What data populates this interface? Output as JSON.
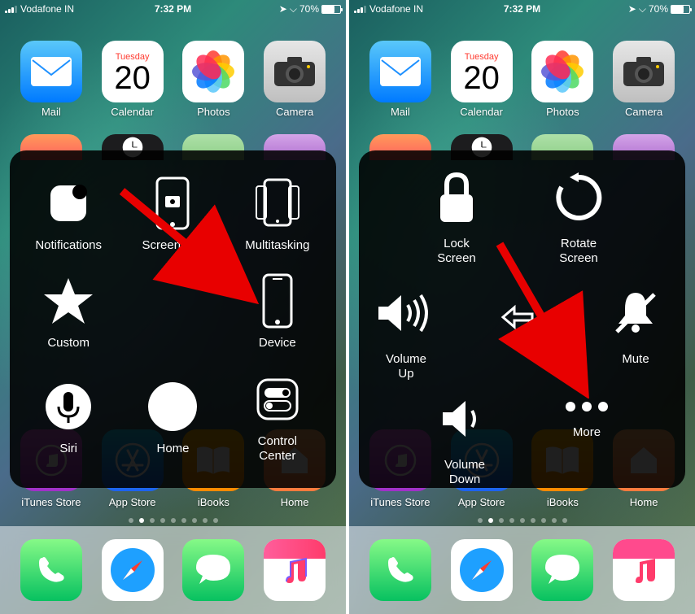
{
  "status": {
    "carrier": "Vodafone IN",
    "time": "7:32 PM",
    "battery_pct": "70%",
    "bluetooth": "✱"
  },
  "apps_row1": [
    {
      "label": "Mail",
      "icon": "mail"
    },
    {
      "label": "Calendar",
      "icon": "calendar",
      "day": "Tuesday",
      "date": "20"
    },
    {
      "label": "Photos",
      "icon": "photos"
    },
    {
      "label": "Camera",
      "icon": "camera"
    }
  ],
  "apps_bottom": [
    {
      "label": "iTunes Store",
      "icon": "itunes"
    },
    {
      "label": "App Store",
      "icon": "appstore"
    },
    {
      "label": "iBooks",
      "icon": "ibooks"
    },
    {
      "label": "Home",
      "icon": "home"
    }
  ],
  "dock": [
    {
      "label": "Phone",
      "icon": "phone"
    },
    {
      "label": "Safari",
      "icon": "safari"
    },
    {
      "label": "Messages",
      "icon": "messages"
    },
    {
      "label": "Music",
      "icon": "music"
    }
  ],
  "assistive1": {
    "items": [
      {
        "label": "Notifications",
        "icon": "notifications"
      },
      {
        "label": "Screenshot",
        "icon": "screenshot"
      },
      {
        "label": "Multitasking",
        "icon": "multitask"
      },
      {
        "label": "Custom",
        "icon": "star"
      },
      {
        "label": "",
        "icon": ""
      },
      {
        "label": "Device",
        "icon": "device"
      },
      {
        "label": "Siri",
        "icon": "siri"
      },
      {
        "label": "Home",
        "icon": "home-circle"
      },
      {
        "label": "Control\nCenter",
        "icon": "control"
      }
    ]
  },
  "assistive2": {
    "lock": "Lock\nScreen",
    "rotate": "Rotate\nScreen",
    "volup": "Volume\nUp",
    "voldown": "Volume\nDown",
    "mute": "Mute",
    "more": "More"
  }
}
